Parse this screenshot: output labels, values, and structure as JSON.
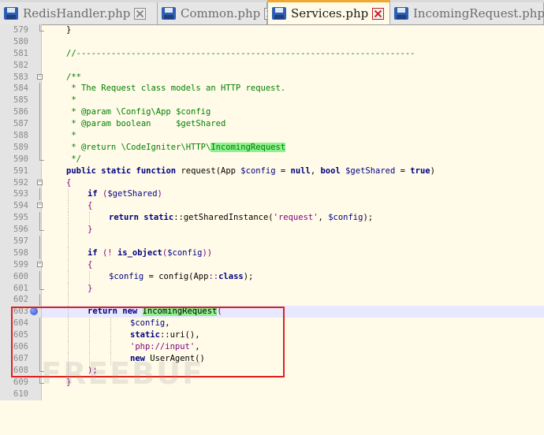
{
  "tabs": [
    {
      "label": "RedisHandler.php",
      "active": false
    },
    {
      "label": "Common.php",
      "active": false
    },
    {
      "label": "Services.php",
      "active": true
    },
    {
      "label": "IncomingRequest.php",
      "active": false
    }
  ],
  "lines": {
    "n579": "579",
    "n580": "580",
    "n581": "581",
    "n582": "582",
    "n583": "583",
    "n584": "584",
    "n585": "585",
    "n586": "586",
    "n587": "587",
    "n588": "588",
    "n589": "589",
    "n590": "590",
    "n591": "591",
    "n592": "592",
    "n593": "593",
    "n594": "594",
    "n595": "595",
    "n596": "596",
    "n597": "597",
    "n598": "598",
    "n599": "599",
    "n600": "600",
    "n601": "601",
    "n602": "602",
    "n603": "603",
    "n604": "604",
    "n605": "605",
    "n606": "606",
    "n607": "607",
    "n608": "608",
    "n609": "609",
    "n610": "610"
  },
  "code": {
    "c579": "}",
    "c581": "//--------------------------------------------------------------------",
    "c583": "/**",
    "c584": " * The Request class models an HTTP request.",
    "c585": " *",
    "c586": " * @param \\Config\\App $config",
    "c587": " * @param boolean     $getShared",
    "c588": " *",
    "c589a": " * @return \\CodeIgniter\\HTTP\\",
    "c589b": "IncomingRequest",
    "c590": " */",
    "c591_public": "public",
    "c591_static": "static",
    "c591_function": "function",
    "c591_name": "request(App ",
    "c591_config": "$config",
    "c591_eq1": " = ",
    "c591_null": "null",
    "c591_comma": ", ",
    "c591_bool": "bool",
    "c591_space": " ",
    "c591_getshared": "$getShared",
    "c591_eq2": " = ",
    "c591_true": "true",
    "c591_close": ")",
    "c592": "{",
    "c593_if": "if",
    "c593_open": " (",
    "c593_var": "$getShared",
    "c593_close": ")",
    "c594": "{",
    "c595_return": "return",
    "c595_static": "static",
    "c595_call": "::getSharedInstance(",
    "c595_str": "'request'",
    "c595_comma": ", ",
    "c595_var": "$config",
    "c595_close": ");",
    "c596": "}",
    "c598_if": "if",
    "c598_open": " (! ",
    "c598_fn": "is_object",
    "c598_paren": "(",
    "c598_var": "$config",
    "c598_close": "))",
    "c599": "{",
    "c600_var": "$config",
    "c600_eq": " = config(App",
    "c600_cc": "::",
    "c600_class": "class",
    "c600_close": ");",
    "c601": "}",
    "c603_return": "return",
    "c603_new": "new",
    "c603_cls": "IncomingRequest",
    "c603_paren": "(",
    "c604_var": "$config",
    "c604_comma": ",",
    "c605_static": "static",
    "c605_call": "::uri(),",
    "c606_str": "'php://input'",
    "c606_comma": ",",
    "c607_new": "new",
    "c607_call": " UserAgent()",
    "c608": ");",
    "c609": "}"
  },
  "watermark": "FREEBUF",
  "colors": {
    "keyword": "#00007f",
    "comment": "#007f00",
    "string": "#7f007f",
    "highlight": "#8ef08e",
    "annotation": "#e02020"
  }
}
